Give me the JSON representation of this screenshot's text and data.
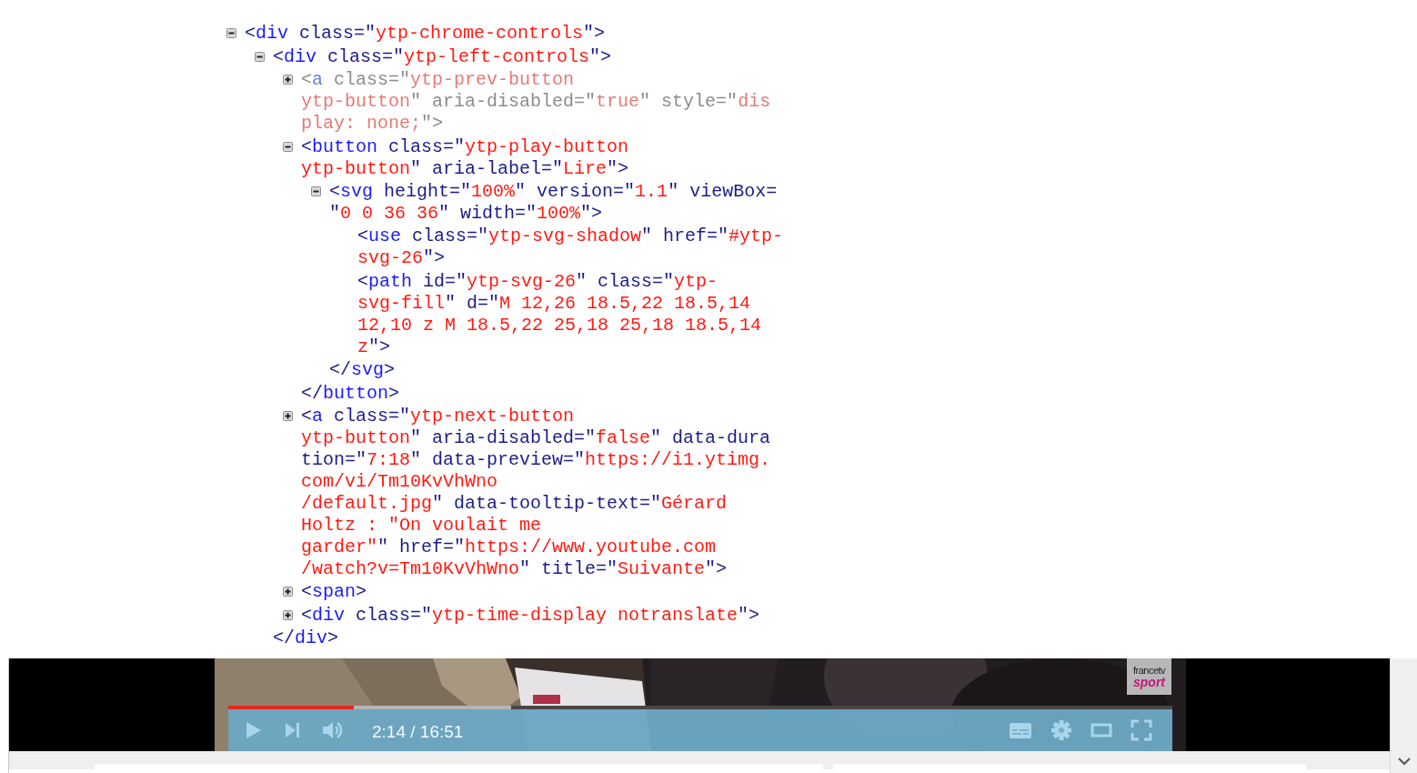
{
  "dom_tree": {
    "nodes": [
      {
        "expanded": true,
        "dimmed": false,
        "lines": [
          [
            {
              "kind": "punct",
              "text": "<"
            },
            {
              "kind": "tag",
              "text": "div"
            },
            {
              "kind": "punct",
              "text": " class=\""
            },
            {
              "kind": "value",
              "text": "ytp-chrome-controls"
            },
            {
              "kind": "punct",
              "text": "\">"
            }
          ]
        ],
        "children": [
          {
            "expanded": true,
            "dimmed": false,
            "lines": [
              [
                {
                  "kind": "punct",
                  "text": "<"
                },
                {
                  "kind": "tag",
                  "text": "div"
                },
                {
                  "kind": "punct",
                  "text": " class=\""
                },
                {
                  "kind": "value",
                  "text": "ytp-left-controls"
                },
                {
                  "kind": "punct",
                  "text": "\">"
                }
              ]
            ],
            "children": [
              {
                "expanded": false,
                "dimmed": true,
                "lines": [
                  [
                    {
                      "kind": "punct",
                      "text": "<"
                    },
                    {
                      "kind": "tag",
                      "text": "a"
                    },
                    {
                      "kind": "punct",
                      "text": " class=\""
                    },
                    {
                      "kind": "value",
                      "text": "ytp-prev-button"
                    }
                  ],
                  [
                    {
                      "kind": "value",
                      "text": "ytp-button"
                    },
                    {
                      "kind": "punct",
                      "text": "\" aria-disabled=\""
                    },
                    {
                      "kind": "value",
                      "text": "true"
                    },
                    {
                      "kind": "punct",
                      "text": "\" style=\""
                    },
                    {
                      "kind": "value",
                      "text": "dis"
                    }
                  ],
                  [
                    {
                      "kind": "value",
                      "text": "play: none;"
                    },
                    {
                      "kind": "punct",
                      "text": "\">"
                    }
                  ]
                ]
              },
              {
                "expanded": true,
                "dimmed": false,
                "lines": [
                  [
                    {
                      "kind": "punct",
                      "text": "<"
                    },
                    {
                      "kind": "tag",
                      "text": "button"
                    },
                    {
                      "kind": "punct",
                      "text": " class=\""
                    },
                    {
                      "kind": "value",
                      "text": "ytp-play-button"
                    }
                  ],
                  [
                    {
                      "kind": "value",
                      "text": "ytp-button"
                    },
                    {
                      "kind": "punct",
                      "text": "\" aria-label=\""
                    },
                    {
                      "kind": "value",
                      "text": "Lire"
                    },
                    {
                      "kind": "punct",
                      "text": "\">"
                    }
                  ]
                ],
                "children": [
                  {
                    "expanded": true,
                    "dimmed": false,
                    "lines": [
                      [
                        {
                          "kind": "punct",
                          "text": "<"
                        },
                        {
                          "kind": "tag",
                          "text": "svg"
                        },
                        {
                          "kind": "punct",
                          "text": " height=\""
                        },
                        {
                          "kind": "value",
                          "text": "100%"
                        },
                        {
                          "kind": "punct",
                          "text": "\" version=\""
                        },
                        {
                          "kind": "value",
                          "text": "1.1"
                        },
                        {
                          "kind": "punct",
                          "text": "\" viewBox="
                        }
                      ],
                      [
                        {
                          "kind": "punct",
                          "text": "\""
                        },
                        {
                          "kind": "value",
                          "text": "0 0 36 36"
                        },
                        {
                          "kind": "punct",
                          "text": "\" width=\""
                        },
                        {
                          "kind": "value",
                          "text": "100%"
                        },
                        {
                          "kind": "punct",
                          "text": "\">"
                        }
                      ]
                    ],
                    "children": [
                      {
                        "dimmed": false,
                        "lines": [
                          [
                            {
                              "kind": "punct",
                              "text": "<"
                            },
                            {
                              "kind": "tag",
                              "text": "use"
                            },
                            {
                              "kind": "punct",
                              "text": " class=\""
                            },
                            {
                              "kind": "value",
                              "text": "ytp-svg-shadow"
                            },
                            {
                              "kind": "punct",
                              "text": "\" href=\""
                            },
                            {
                              "kind": "value",
                              "text": "#ytp-"
                            }
                          ],
                          [
                            {
                              "kind": "value",
                              "text": "svg-26"
                            },
                            {
                              "kind": "punct",
                              "text": "\">"
                            }
                          ]
                        ]
                      },
                      {
                        "dimmed": false,
                        "lines": [
                          [
                            {
                              "kind": "punct",
                              "text": "<"
                            },
                            {
                              "kind": "tag",
                              "text": "path"
                            },
                            {
                              "kind": "punct",
                              "text": " id=\""
                            },
                            {
                              "kind": "value",
                              "text": "ytp-svg-26"
                            },
                            {
                              "kind": "punct",
                              "text": "\" class=\""
                            },
                            {
                              "kind": "value",
                              "text": "ytp-"
                            }
                          ],
                          [
                            {
                              "kind": "value",
                              "text": "svg-fill"
                            },
                            {
                              "kind": "punct",
                              "text": "\" d=\""
                            },
                            {
                              "kind": "value",
                              "text": "M 12,26 18.5,22 18.5,14"
                            }
                          ],
                          [
                            {
                              "kind": "value",
                              "text": "12,10 z M 18.5,22 25,18 25,18 18.5,14"
                            }
                          ],
                          [
                            {
                              "kind": "value",
                              "text": "z"
                            },
                            {
                              "kind": "punct",
                              "text": "\">"
                            }
                          ]
                        ]
                      }
                    ],
                    "closing": [
                      {
                        "kind": "punct",
                        "text": "</"
                      },
                      {
                        "kind": "tag",
                        "text": "svg"
                      },
                      {
                        "kind": "punct",
                        "text": ">"
                      }
                    ]
                  }
                ],
                "closing": [
                  {
                    "kind": "punct",
                    "text": "</"
                  },
                  {
                    "kind": "tag",
                    "text": "button"
                  },
                  {
                    "kind": "punct",
                    "text": ">"
                  }
                ]
              },
              {
                "expanded": false,
                "dimmed": false,
                "lines": [
                  [
                    {
                      "kind": "punct",
                      "text": "<"
                    },
                    {
                      "kind": "tag",
                      "text": "a"
                    },
                    {
                      "kind": "punct",
                      "text": " class=\""
                    },
                    {
                      "kind": "value",
                      "text": "ytp-next-button"
                    }
                  ],
                  [
                    {
                      "kind": "value",
                      "text": "ytp-button"
                    },
                    {
                      "kind": "punct",
                      "text": "\" aria-disabled=\""
                    },
                    {
                      "kind": "value",
                      "text": "false"
                    },
                    {
                      "kind": "punct",
                      "text": "\" data-dura"
                    }
                  ],
                  [
                    {
                      "kind": "punct",
                      "text": "tion=\""
                    },
                    {
                      "kind": "value",
                      "text": "7:18"
                    },
                    {
                      "kind": "punct",
                      "text": "\" data-preview=\""
                    },
                    {
                      "kind": "value",
                      "text": "https://i1.ytimg."
                    }
                  ],
                  [
                    {
                      "kind": "value",
                      "text": "com/vi/Tm10KvVhWno"
                    }
                  ],
                  [
                    {
                      "kind": "value",
                      "text": "/default.jpg"
                    },
                    {
                      "kind": "punct",
                      "text": "\" data-tooltip-text=\""
                    },
                    {
                      "kind": "value",
                      "text": "Gérard"
                    }
                  ],
                  [
                    {
                      "kind": "value",
                      "text": "Holtz : \"On voulait me"
                    }
                  ],
                  [
                    {
                      "kind": "value",
                      "text": "garder\""
                    },
                    {
                      "kind": "punct",
                      "text": "\" href=\""
                    },
                    {
                      "kind": "value",
                      "text": "https://www.youtube.com"
                    }
                  ],
                  [
                    {
                      "kind": "value",
                      "text": "/watch?v=Tm10KvVhWno"
                    },
                    {
                      "kind": "punct",
                      "text": "\" title=\""
                    },
                    {
                      "kind": "value",
                      "text": "Suivante"
                    },
                    {
                      "kind": "punct",
                      "text": "\">"
                    }
                  ]
                ]
              },
              {
                "expanded": false,
                "dimmed": false,
                "lines": [
                  [
                    {
                      "kind": "punct",
                      "text": "<"
                    },
                    {
                      "kind": "tag",
                      "text": "span"
                    },
                    {
                      "kind": "punct",
                      "text": ">"
                    }
                  ]
                ]
              },
              {
                "expanded": false,
                "dimmed": false,
                "lines": [
                  [
                    {
                      "kind": "punct",
                      "text": "<"
                    },
                    {
                      "kind": "tag",
                      "text": "div"
                    },
                    {
                      "kind": "punct",
                      "text": " class=\""
                    },
                    {
                      "kind": "value",
                      "text": "ytp-time-display notranslate"
                    },
                    {
                      "kind": "punct",
                      "text": "\">"
                    }
                  ]
                ]
              }
            ],
            "closing": [
              {
                "kind": "punct",
                "text": "</"
              },
              {
                "kind": "tag",
                "text": "div"
              },
              {
                "kind": "punct",
                "text": ">"
              }
            ]
          }
        ]
      }
    ]
  },
  "player": {
    "logo": {
      "line_1": "francetv",
      "line_2": "sport"
    },
    "progress": {
      "level": 0.133
    },
    "buffer": {
      "level": 0.3
    },
    "time": "2:14 / 16:51"
  }
}
